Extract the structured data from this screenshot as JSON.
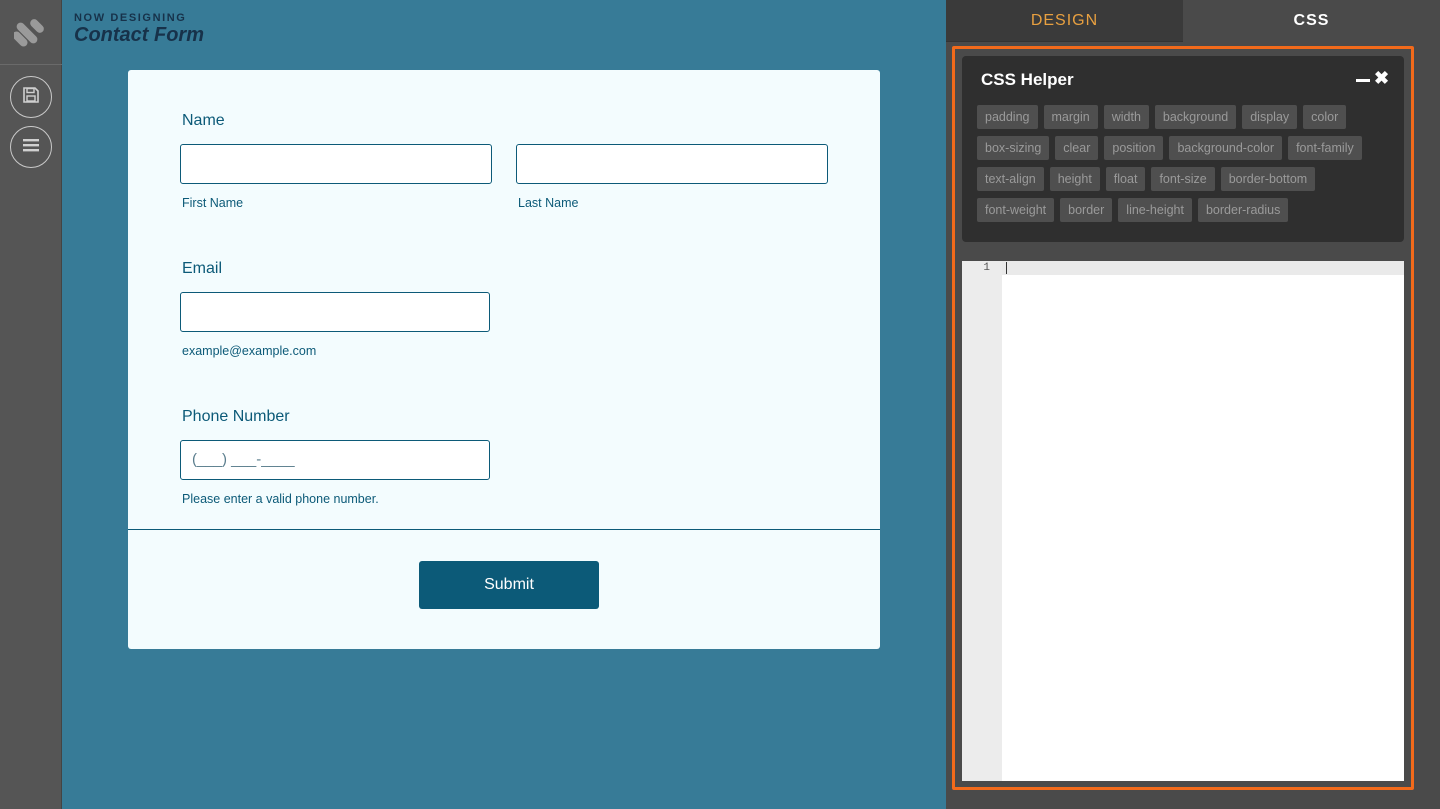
{
  "header": {
    "eyebrow": "NOW DESIGNING",
    "title": "Contact Form"
  },
  "form": {
    "name_label": "Name",
    "first_name_sublabel": "First Name",
    "last_name_sublabel": "Last Name",
    "email_label": "Email",
    "email_sublabel": "example@example.com",
    "phone_label": "Phone Number",
    "phone_placeholder": "(___) ___-____",
    "phone_sublabel": "Please enter a valid phone number.",
    "submit_label": "Submit"
  },
  "panel": {
    "tabs": [
      {
        "label": "DESIGN",
        "active": false
      },
      {
        "label": "CSS",
        "active": true
      }
    ],
    "helper": {
      "title": "CSS Helper",
      "close_glyph": "✖",
      "chip_rows": [
        [
          "padding",
          "margin",
          "width",
          "background",
          "display",
          "color"
        ],
        [
          "box-sizing",
          "clear",
          "position",
          "background-color",
          "font-family"
        ],
        [
          "text-align",
          "height",
          "float",
          "font-size",
          "border-bottom"
        ],
        [
          "font-weight",
          "border",
          "line-height",
          "border-radius"
        ]
      ]
    },
    "editor": {
      "line_number": "1",
      "content": ""
    }
  },
  "colors": {
    "canvas": "#377b97",
    "form_background": "#f3fcfe",
    "accent": "#0c5a78",
    "frame_highlight": "#f26a1b",
    "design_tab_text": "#e8a040"
  },
  "icons": [
    "app-logo-icon",
    "save-icon",
    "hamburger-menu-icon",
    "minimize-icon",
    "close-icon"
  ]
}
